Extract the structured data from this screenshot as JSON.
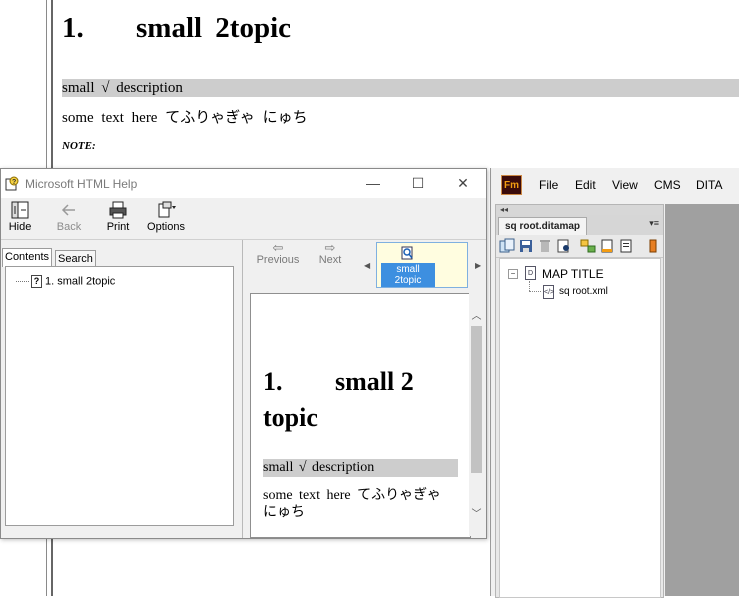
{
  "background_doc": {
    "heading_number": "1.",
    "heading_text": "small  2topic",
    "shortdesc": "small  √  description",
    "paragraph": "some  text  here  てふりゃぎゃ  にゅち",
    "note_label": "NOTE:"
  },
  "help_window": {
    "title": "Microsoft HTML Help",
    "controls": {
      "minimize": "—",
      "maximize": "☐",
      "close": "✕"
    },
    "toolbar": {
      "hide": "Hide",
      "back": "Back",
      "print": "Print",
      "options": "Options"
    },
    "nav_tabs": {
      "contents": "Contents",
      "search": "Search"
    },
    "toc": [
      {
        "label": "1. small 2topic",
        "icon": "help-page-icon"
      }
    ],
    "nav": {
      "previous": "Previous",
      "next": "Next",
      "selected_topic_line1": "small",
      "selected_topic_line2": "2topic"
    },
    "content": {
      "heading_number": "1.",
      "heading_text": "small  2 topic",
      "shortdesc": "small  √  description",
      "paragraph": "some  text  here  てふりゃぎゃ にゅち"
    }
  },
  "framemaker": {
    "logo": "Fm",
    "menu": [
      "File",
      "Edit",
      "View",
      "CMS",
      "DITA"
    ],
    "panel_collapse": "◂◂",
    "tab_label": "sq root.ditamap",
    "tab_menu": "▾≡",
    "tree": {
      "root_label": "MAP TITLE",
      "child_label": "sq root.xml"
    }
  },
  "colors": {
    "shortdesc_bg": "#cdcdcd",
    "selection_blue": "#3d8fe0",
    "fm_gray": "#a0a0a0"
  }
}
